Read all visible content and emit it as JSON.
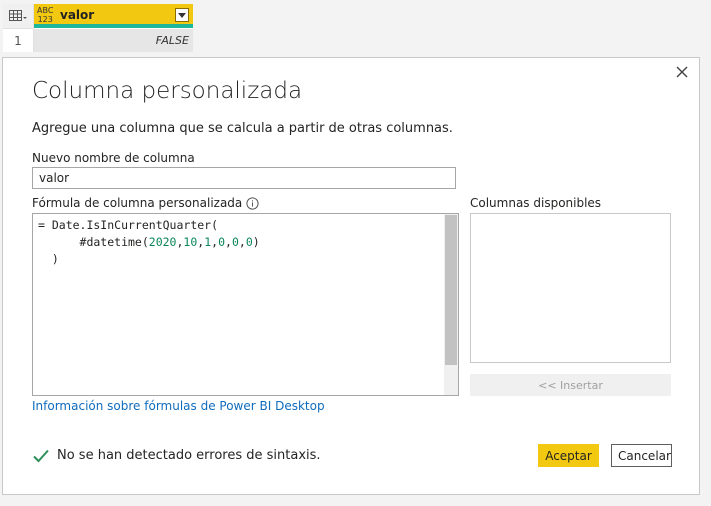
{
  "table": {
    "type_badge_top": "ABC",
    "type_badge_bottom": "123",
    "column_name": "valor",
    "row_number": "1",
    "cell_value": "FALSE"
  },
  "dialog": {
    "title": "Columna personalizada",
    "subtitle": "Agregue una columna que se calcula a partir de otras columnas.",
    "new_column_label": "Nuevo nombre de columna",
    "new_column_value": "valor",
    "formula_label": "Fórmula de columna personalizada",
    "formula_lines": {
      "line1": "= Date.IsInCurrentQuarter(",
      "line2_prefix": "      #datetime(",
      "line2_args": [
        "2020",
        "10",
        "1",
        "0",
        "0",
        "0"
      ],
      "line2_suffix": ")",
      "line3": "  )"
    },
    "available_columns_label": "Columnas disponibles",
    "insert_label": "<< Insertar",
    "help_link": "Información sobre fórmulas de Power BI Desktop",
    "status_text": "No se han detectado errores de sintaxis.",
    "ok_label": "Aceptar",
    "cancel_label": "Cancelar"
  },
  "colors": {
    "accent": "#f2c811",
    "header_underline": "#1fb79c",
    "link": "#0f6cbd",
    "success": "#2f8f5a",
    "number": "#098658"
  },
  "icons": {
    "table": "table-icon",
    "dropdown": "chevron-down-icon",
    "close": "close-icon",
    "info": "info-icon",
    "status": "check-icon"
  }
}
